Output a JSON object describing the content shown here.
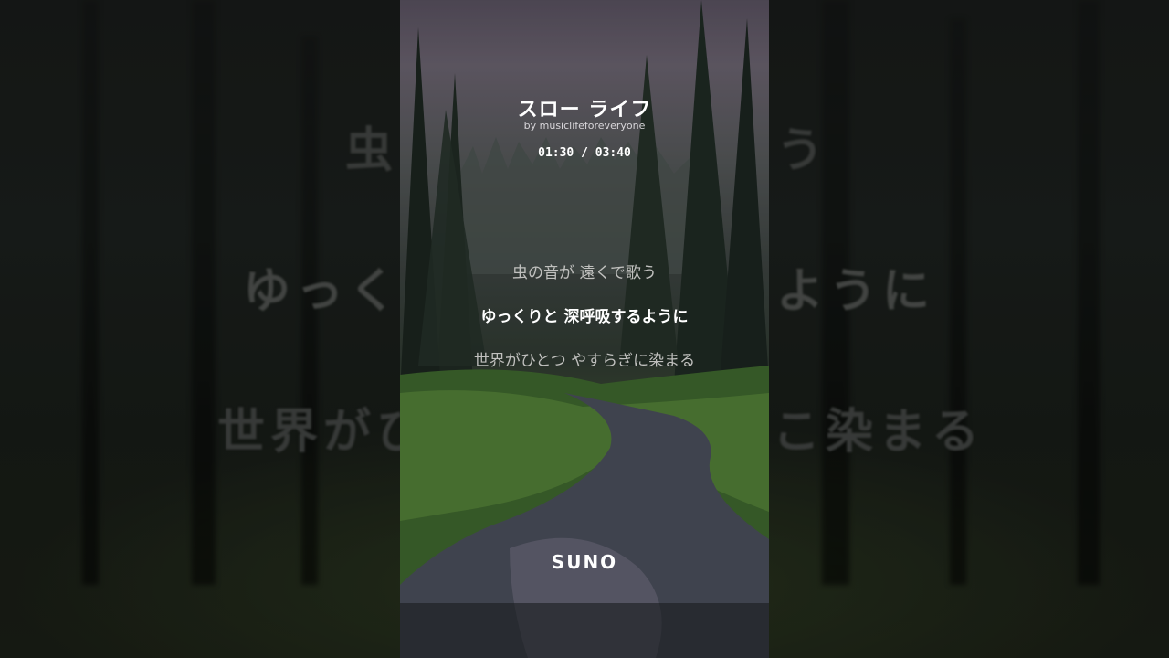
{
  "song": {
    "title": "スロー ライフ",
    "artist": "by musiclifeforeveryone",
    "time": "01:30 / 03:40"
  },
  "lyrics": {
    "previous": "虫の音が 遠くで歌う",
    "current": "ゆっくりと 深呼吸するように",
    "next": "世界がひとつ やすらぎに染まる"
  },
  "background_lyrics": {
    "left_top": "虫",
    "right_top": "う",
    "left_mid": "ゆっく",
    "right_mid": "ように",
    "left_bottom": "世界がひ",
    "right_bottom": "こ染まる"
  },
  "brand": {
    "logo": "SUNO"
  },
  "colors": {
    "text_primary": "#ffffff",
    "text_secondary": "#c0c0be",
    "sky": "#6c6470",
    "grass": "#4f7a34",
    "water": "#4a4e58"
  }
}
